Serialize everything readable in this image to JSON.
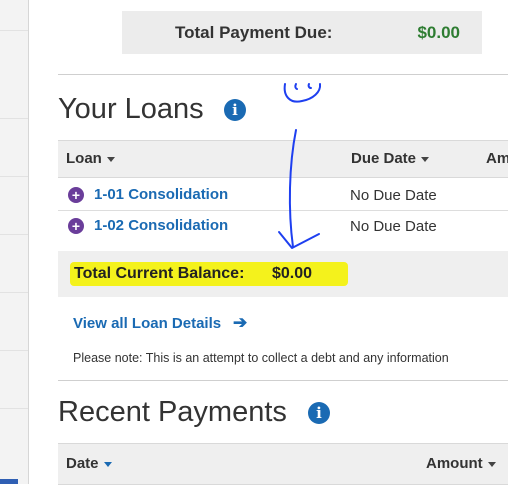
{
  "payment_due": {
    "label": "Total Payment Due:",
    "amount": "$0.00"
  },
  "loans": {
    "title": "Your Loans",
    "columns": {
      "loan": "Loan",
      "due_date": "Due Date",
      "amount": "Am"
    },
    "rows": [
      {
        "name": "1-01 Consolidation",
        "due": "No Due Date"
      },
      {
        "name": "1-02 Consolidation",
        "due": "No Due Date"
      }
    ],
    "balance_label": "Total Current Balance:",
    "balance_value": "$0.00",
    "view_all": "View all Loan Details",
    "note": "Please note: This is an attempt to collect a debt and any information"
  },
  "payments": {
    "title": "Recent Payments",
    "columns": {
      "date": "Date",
      "amount": "Amount"
    }
  },
  "colors": {
    "link": "#1a6ab3",
    "positive": "#2e7d32",
    "highlight": "#f4f21c",
    "annotation": "#1e3ff0"
  },
  "icons": {
    "info": "info-icon",
    "expand": "plus-circle-icon",
    "arrow": "arrow-right-icon",
    "sort": "caret-down-icon"
  }
}
